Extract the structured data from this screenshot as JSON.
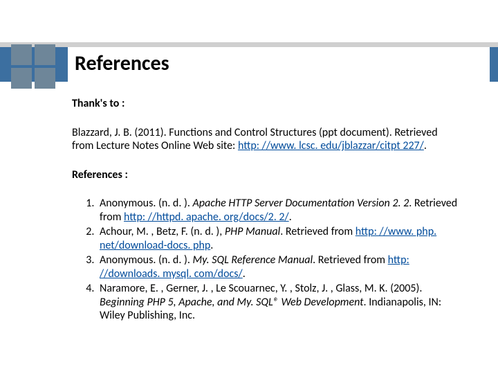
{
  "title": "References",
  "thanks": {
    "label": "Thank's to :",
    "entry_pre": "Blazzard, J. B. (2011). Functions and Control Structures (ppt document). Retrieved from Lecture Notes Online Web site: ",
    "entry_link": "http: //www. lcsc. edu/jblazzar/citpt 227/",
    "entry_post": "."
  },
  "references": {
    "label": "References :",
    "items": [
      {
        "pre": "Anonymous. (n. d. ).  ",
        "ital": "Apache HTTP Server Documentation Version 2. 2",
        "mid": ". Retrieved from ",
        "link": "http: //httpd. apache. org/docs/2. 2/",
        "post": "."
      },
      {
        "pre": "Achour, M. , Betz, F. (n. d. ), ",
        "ital": "PHP Manual",
        "mid": ". Retrieved from ",
        "link": "http: //www. php. net/download-docs. php",
        "post": "."
      },
      {
        "pre": "Anonymous. (n. d. ). ",
        "ital": "My. SQL Reference Manual",
        "mid": ". Retrieved from ",
        "link": "http: //downloads. mysql. com/docs/",
        "post": "."
      },
      {
        "pre": "Naramore, E. , Gerner, J. , Le Scouarnec, Y. , Stolz, J. , Glass, M. K. (2005). ",
        "ital": "Beginning PHP 5, Apache, and My. SQL® Web Development",
        "mid": ". Indianapolis, IN:  Wiley Publishing, Inc.",
        "link": "",
        "post": ""
      }
    ]
  }
}
